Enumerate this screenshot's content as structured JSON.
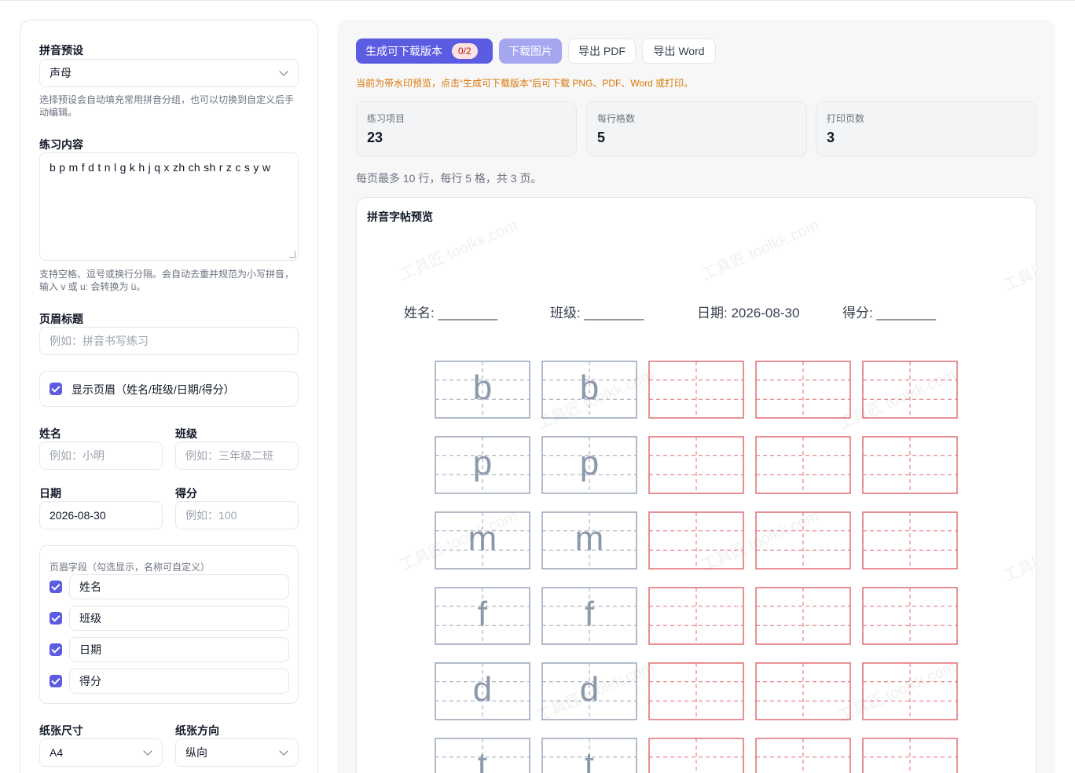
{
  "left": {
    "preset_label": "拼音预设",
    "preset_value": "声母",
    "preset_hint": "选择预设会自动填充常用拼音分组，也可以切换到自定义后手动编辑。",
    "content_label": "练习内容",
    "content_value": "b p m f d t n l g k h j q x zh ch sh r z c s y w",
    "content_hint": "支持空格、逗号或换行分隔。会自动去重并规范为小写拼音，输入 v 或 u: 会转换为 ü。",
    "title_label": "页眉标题",
    "title_placeholder": "例如：拼音书写练习",
    "show_header_label": "显示页眉（姓名/班级/日期/得分）",
    "name_label": "姓名",
    "name_placeholder": "例如：小明",
    "class_label": "班级",
    "class_placeholder": "例如：三年级二班",
    "date_label": "日期",
    "date_value": "2026-08-30",
    "score_label": "得分",
    "score_placeholder": "例如：100",
    "fields_title": "页眉字段（勾选显示，名称可自定义）",
    "fields": [
      "姓名",
      "班级",
      "日期",
      "得分"
    ],
    "paper_label": "纸张尺寸",
    "paper_value": "A4",
    "orientation_label": "纸张方向",
    "orientation_value": "纵向"
  },
  "toolbar": {
    "generate_label": "生成可下载版本",
    "generate_badge": "0/2",
    "download_image_label": "下载图片",
    "export_pdf_label": "导出 PDF",
    "export_word_label": "导出 Word"
  },
  "notice": "当前为带水印预览，点击“生成可下载版本”后可下载 PNG、PDF、Word 或打印。",
  "stats": [
    {
      "label": "练习项目",
      "value": "23"
    },
    {
      "label": "每行格数",
      "value": "5"
    },
    {
      "label": "打印页数",
      "value": "3"
    }
  ],
  "summary": "每页最多 10 行，每行 5 格，共 3 页。",
  "preview": {
    "title": "拼音字帖预览",
    "header_fields": [
      "姓名: ________",
      "班级: ________",
      "日期: 2026-08-30",
      "得分: ________"
    ],
    "rows": [
      "b",
      "p",
      "m",
      "f",
      "d",
      "t"
    ],
    "cells_per_row": 5,
    "trace_cells": 2,
    "watermark_text": "工具匠 toolkk.com"
  },
  "colors": {
    "accent": "#5b5ce2",
    "trace_grid": "#9aa6b5",
    "practice_grid": "#e26d72",
    "notice": "#d97706"
  }
}
